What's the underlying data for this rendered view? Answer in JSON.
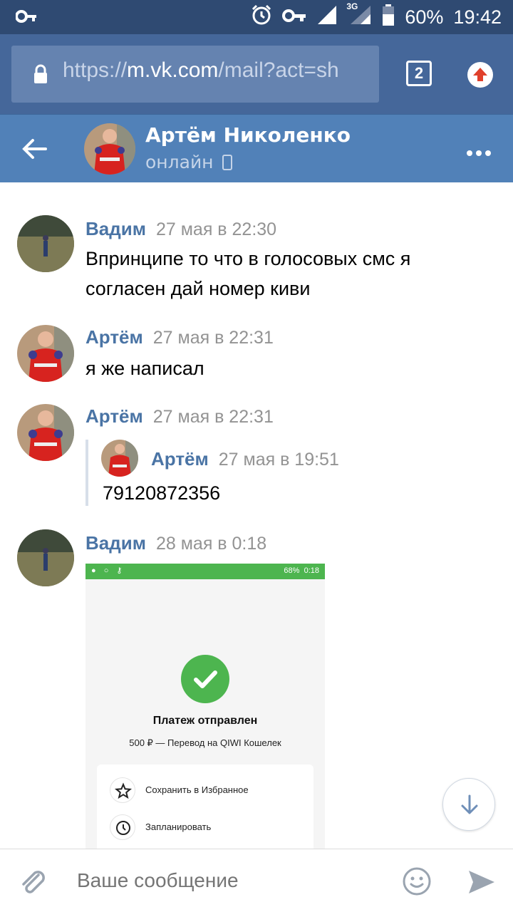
{
  "status_bar": {
    "battery": "60%",
    "time": "19:42",
    "network": "3G",
    "icons": [
      "key-icon",
      "alarm-icon",
      "vpn-key-icon",
      "signal-icon",
      "battery-icon"
    ]
  },
  "browser": {
    "url_scheme": "https://",
    "url_host": "m.vk.com",
    "url_path": "/mail?act=sh",
    "tab_count": "2"
  },
  "header": {
    "name": "Артём Николенко",
    "status": "онлайн"
  },
  "messages": [
    {
      "author": "Вадим",
      "time": "27 мая в 22:30",
      "text": "Впринципе то что в голосовых смс я согласен дай номер киви"
    },
    {
      "author": "Артём",
      "time": "27 мая в 22:31",
      "text": "я же написал"
    },
    {
      "author": "Артём",
      "time": "27 мая в 22:31",
      "forwarded": {
        "author": "Артём",
        "time": "27 мая в 19:51",
        "text": "79120872356"
      }
    },
    {
      "author": "Вадим",
      "time": "28 мая в 0:18",
      "attachment": {
        "statusbar_battery": "68%",
        "statusbar_time": "0:18",
        "title": "Платеж отправлен",
        "subtitle": "500 ₽ — Перевод на QIWI Кошелек",
        "actions": [
          "Сохранить в Избранное",
          "Запланировать"
        ]
      }
    }
  ],
  "composer": {
    "placeholder": "Ваше сообщение"
  },
  "colors": {
    "status_bar": "#2f4a72",
    "url_bar": "#45679a",
    "header": "#5181b8",
    "author": "#4a74a5",
    "qiwi_green": "#4db54f"
  }
}
